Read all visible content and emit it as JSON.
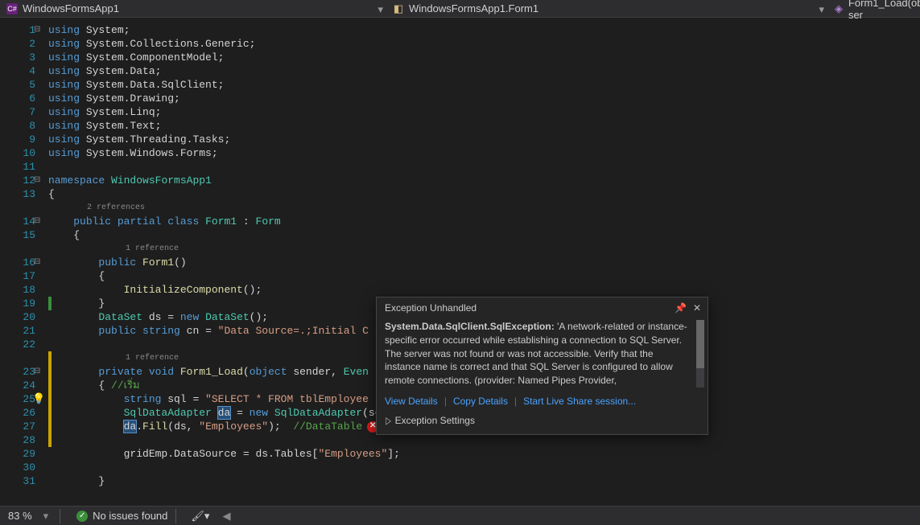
{
  "breadcrumbs": {
    "project": "WindowsFormsApp1",
    "class": "WindowsFormsApp1.Form1",
    "method": "Form1_Load(object ser"
  },
  "codelens": {
    "ref2": "2 references",
    "ref1": "1 reference",
    "ref1b": "1 reference"
  },
  "lines": [
    {
      "n": 1,
      "pre": "",
      "html": "<span class='k'>using</span> System;"
    },
    {
      "n": 2,
      "pre": "",
      "html": "<span class='k'>using</span> System.Collections.Generic;"
    },
    {
      "n": 3,
      "pre": "",
      "html": "<span class='k'>using</span> System.ComponentModel;"
    },
    {
      "n": 4,
      "pre": "",
      "html": "<span class='k'>using</span> System.Data;"
    },
    {
      "n": 5,
      "pre": "",
      "html": "<span class='k'>using</span> System.Data.SqlClient;"
    },
    {
      "n": 6,
      "pre": "",
      "html": "<span class='k'>using</span> System.Drawing;"
    },
    {
      "n": 7,
      "pre": "",
      "html": "<span class='k'>using</span> System.Linq;"
    },
    {
      "n": 8,
      "pre": "",
      "html": "<span class='k'>using</span> System.Text;"
    },
    {
      "n": 9,
      "pre": "",
      "html": "<span class='k'>using</span> System.Threading.Tasks;"
    },
    {
      "n": 10,
      "pre": "",
      "html": "<span class='k'>using</span> System.Windows.Forms;"
    },
    {
      "n": 11,
      "pre": "",
      "html": ""
    },
    {
      "n": 12,
      "pre": "",
      "html": "<span class='k'>namespace</span> <span class='t'>WindowsFormsApp1</span>"
    },
    {
      "n": 13,
      "pre": "",
      "html": "{"
    },
    {
      "n": 14,
      "pre": "    ",
      "html": "<span class='k'>public</span> <span class='k'>partial</span> <span class='k'>class</span> <span class='t'>Form1</span> : <span class='t'>Form</span>"
    },
    {
      "n": 15,
      "pre": "    ",
      "html": "{"
    },
    {
      "n": 16,
      "pre": "        ",
      "html": "<span class='k'>public</span> <span class='n'>Form1</span>()"
    },
    {
      "n": 17,
      "pre": "        ",
      "html": "{"
    },
    {
      "n": 18,
      "pre": "            ",
      "html": "<span class='n'>InitializeComponent</span>();"
    },
    {
      "n": 19,
      "pre": "        ",
      "html": "}"
    },
    {
      "n": 20,
      "pre": "        ",
      "html": "<span class='t'>DataSet</span> ds = <span class='k'>new</span> <span class='t'>DataSet</span>();"
    },
    {
      "n": 21,
      "pre": "        ",
      "html": "<span class='k'>public</span> <span class='k'>string</span> cn = <span class='s'>\"Data Source=.;Initial C</span>"
    },
    {
      "n": 22,
      "pre": "",
      "html": ""
    },
    {
      "n": 23,
      "pre": "        ",
      "html": "<span class='k'>private</span> <span class='k'>void</span> <span class='n'>Form1_Load</span>(<span class='k'>object</span> sender, <span class='t'>Even</span>"
    },
    {
      "n": 24,
      "pre": "        ",
      "html": "{ <span class='c'>//เริ่ม</span>"
    },
    {
      "n": 25,
      "pre": "            ",
      "html": "<span class='k'>string</span> sql = <span class='s'>\"SELECT * FROM tblEmployee</span>"
    },
    {
      "n": 26,
      "pre": "            ",
      "html": "<span class='t'>SqlDataAdapter</span> <span class='hl'>da</span> = <span class='k'>new</span> <span class='t'>SqlDataAdapter</span>(sq , cn);"
    },
    {
      "n": 27,
      "pre": "            ",
      "html": "<span class='hl'>da</span>.<span class='n'>Fill</span>(ds, <span class='s'>\"Employees\"</span>);  <span class='c'>//DataTable</span>"
    },
    {
      "n": 28,
      "pre": "",
      "html": ""
    },
    {
      "n": 29,
      "pre": "            ",
      "html": "gridEmp.DataSource = ds.Tables[<span class='s'>\"Employees\"</span>];"
    },
    {
      "n": 30,
      "pre": "",
      "html": ""
    },
    {
      "n": 31,
      "pre": "        ",
      "html": "}"
    }
  ],
  "popup": {
    "title": "Exception Unhandled",
    "type": "System.Data.SqlClient.SqlException:",
    "msg": "'A network-related or instance-specific error occurred while establishing a connection to SQL Server. The server was not found or was not accessible. Verify that the instance name is correct and that SQL Server is configured to allow remote connections. (provider: Named Pipes Provider,",
    "view": "View Details",
    "copy": "Copy Details",
    "share": "Start Live Share session...",
    "settings": "Exception Settings"
  },
  "status": {
    "zoom": "83 %",
    "issues": "No issues found"
  }
}
